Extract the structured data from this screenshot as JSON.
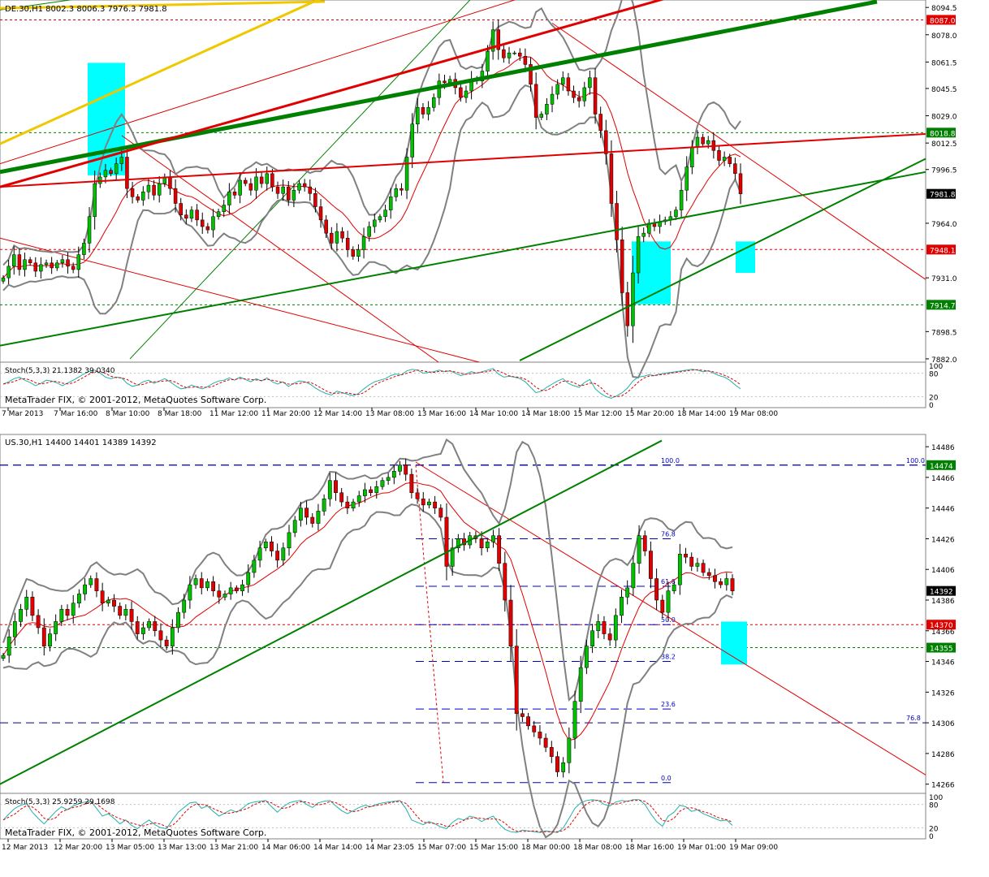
{
  "colors": {
    "bull": "#00c000",
    "bear": "#e00000",
    "band": "#808080",
    "ma": "#e00000",
    "trend_green": "#008000",
    "trend_red": "#e00000",
    "gold": "#f0c800",
    "zone": "#00ffff",
    "fib": "#0000c0",
    "stoch_main": "#20b2aa",
    "stoch_signal": "#e00000",
    "grid": "#c0c0c0"
  },
  "chart_data": [
    {
      "type": "candlestick",
      "symbol_header": "DE.30,H1  8002.3 8006.3 7976.3 7981.8",
      "y_ticks": [
        "8094.5",
        "8078.0",
        "8061.5",
        "8045.5",
        "8029.0",
        "8012.5",
        "7996.5",
        "7964.0",
        "7931.0",
        "7898.5",
        "7882.0"
      ],
      "ylim": [
        7880.0,
        8099.0
      ],
      "price_markers": [
        {
          "label": "8087.0",
          "value": 8087.0,
          "color": "#e00000",
          "style": "dotted"
        },
        {
          "label": "8018.8",
          "value": 8018.8,
          "color": "#008000",
          "style": "dotted"
        },
        {
          "label": "7981.8",
          "value": 7981.8,
          "color": "#000000",
          "style": "current"
        },
        {
          "label": "7948.1",
          "value": 7948.1,
          "color": "#e00000",
          "style": "dotted"
        },
        {
          "label": "7914.7",
          "value": 7914.7,
          "color": "#008000",
          "style": "dotted"
        }
      ],
      "x_ticks": [
        "7 Mar 2013",
        "7 Mar 16:00",
        "8 Mar 10:00",
        "8 Mar 18:00",
        "11 Mar 12:00",
        "11 Mar 20:00",
        "12 Mar 14:00",
        "13 Mar 08:00",
        "13 Mar 16:00",
        "14 Mar 10:00",
        "14 Mar 18:00",
        "15 Mar 12:00",
        "15 Mar 20:00",
        "18 Mar 14:00",
        "19 Mar 08:00"
      ],
      "indicator_label": "Stoch(5,3,3) 21.1382 39.0340",
      "watermark": "MetaTrader FIX, © 2001-2012, MetaQuotes Software Corp.",
      "indicator_ticks": [
        "100",
        "80",
        "20",
        "0"
      ],
      "close": [
        7931,
        7938,
        7945,
        7936,
        7942,
        7940,
        7935,
        7939,
        7940,
        7937,
        7940,
        7942,
        7938,
        7936,
        7945,
        7952,
        7968,
        7988,
        7992,
        7996,
        7994,
        8000,
        8004,
        7985,
        7980,
        7978,
        7983,
        7987,
        7981,
        7988,
        7992,
        7985,
        7976,
        7969,
        7967,
        7972,
        7966,
        7962,
        7960,
        7968,
        7971,
        7975,
        7983,
        7981,
        7990,
        7988,
        7984,
        7992,
        7988,
        7994,
        7986,
        7982,
        7986,
        7978,
        7984,
        7988,
        7986,
        7982,
        7974,
        7966,
        7958,
        7952,
        7959,
        7955,
        7948,
        7944,
        7948,
        7956,
        7962,
        7966,
        7968,
        7972,
        7980,
        7985,
        7984,
        8004,
        8024,
        8034,
        8030,
        8034,
        8040,
        8050,
        8049,
        8051,
        8046,
        8040,
        8044,
        8051,
        8050,
        8056,
        8068,
        8081,
        8069,
        8064,
        8067,
        8067,
        8065,
        8060,
        8048,
        8028,
        8030,
        8036,
        8042,
        8048,
        8052,
        8044,
        8040,
        8038,
        8046,
        8052,
        8030,
        8020,
        8006,
        7976,
        7954,
        7922,
        7902,
        7934,
        7956,
        7958,
        7964,
        7962,
        7965,
        7966,
        7968,
        7972,
        7984,
        7998,
        8010,
        8016,
        8012,
        8014,
        8008,
        8002,
        8004,
        8000,
        7994,
        7981.8
      ],
      "stoch_main": [
        52,
        58,
        66,
        70,
        62,
        56,
        48,
        54,
        62,
        60,
        55,
        48,
        55,
        62,
        70,
        78,
        85,
        88,
        80,
        70,
        66,
        70,
        68,
        54,
        46,
        50,
        58,
        62,
        54,
        60,
        66,
        58,
        48,
        40,
        42,
        50,
        44,
        40,
        46,
        54,
        60,
        62,
        68,
        62,
        70,
        64,
        58,
        66,
        60,
        68,
        58,
        52,
        58,
        46,
        54,
        60,
        58,
        52,
        42,
        34,
        28,
        24,
        34,
        30,
        26,
        22,
        28,
        40,
        50,
        58,
        62,
        66,
        74,
        78,
        76,
        86,
        90,
        88,
        80,
        82,
        84,
        88,
        84,
        86,
        80,
        74,
        78,
        84,
        80,
        84,
        88,
        92,
        78,
        70,
        72,
        70,
        66,
        58,
        44,
        30,
        34,
        44,
        52,
        60,
        66,
        54,
        48,
        44,
        56,
        64,
        40,
        28,
        20,
        16,
        22,
        30,
        42,
        60,
        70,
        72,
        76,
        74,
        78,
        80,
        82,
        84,
        86,
        88,
        90,
        88,
        84,
        86,
        80,
        74,
        70,
        62,
        50,
        40
      ]
    },
    {
      "type": "candlestick",
      "symbol_header": "US.30,H1  14400 14401 14389 14392",
      "y_ticks": [
        "14486",
        "14466",
        "14446",
        "14426",
        "14406",
        "14386",
        "14366",
        "14346",
        "14326",
        "14306",
        "14286",
        "14266"
      ],
      "ylim": [
        14260,
        14494
      ],
      "price_markers": [
        {
          "label": "14474",
          "value": 14474,
          "color": "#008000",
          "style": "dashed"
        },
        {
          "label": "14392",
          "value": 14392,
          "color": "#000000",
          "style": "current"
        },
        {
          "label": "14370",
          "value": 14370,
          "color": "#e00000",
          "style": "dotted"
        },
        {
          "label": "14355",
          "value": 14355,
          "color": "#008000",
          "style": "dotted"
        }
      ],
      "fib_levels": [
        {
          "label": "100.0",
          "value": 14474
        },
        {
          "label": "76.8",
          "value": 14426
        },
        {
          "label": "61.8",
          "value": 14395
        },
        {
          "label": "50.0",
          "value": 14370
        },
        {
          "label": "38.2",
          "value": 14346
        },
        {
          "label": "23.6",
          "value": 14315
        },
        {
          "label": "0.0",
          "value": 14267
        }
      ],
      "fib_ext_labels": [
        {
          "label": "100.0",
          "value": 14474
        },
        {
          "label": "76.8",
          "value": 14306
        }
      ],
      "x_ticks": [
        "12 Mar 2013",
        "12 Mar 20:00",
        "13 Mar 05:00",
        "13 Mar 13:00",
        "13 Mar 21:00",
        "14 Mar 06:00",
        "14 Mar 14:00",
        "14 Mar 23:05",
        "15 Mar 07:00",
        "15 Mar 15:00",
        "18 Mar 00:00",
        "18 Mar 08:00",
        "18 Mar 16:00",
        "19 Mar 01:00",
        "19 Mar 09:00"
      ],
      "indicator_label": "Stoch(5,3,3) 25.9259 29.1698",
      "watermark": "MetaTrader FIX, © 2001-2012, MetaQuotes Software Corp.",
      "indicator_ticks": [
        "100",
        "80",
        "20",
        "0"
      ],
      "close": [
        14350,
        14362,
        14372,
        14380,
        14388,
        14376,
        14368,
        14356,
        14364,
        14372,
        14380,
        14376,
        14384,
        14390,
        14396,
        14400,
        14392,
        14384,
        14386,
        14382,
        14376,
        14380,
        14372,
        14364,
        14368,
        14372,
        14366,
        14360,
        14356,
        14368,
        14378,
        14386,
        14396,
        14400,
        14394,
        14398,
        14392,
        14388,
        14390,
        14394,
        14392,
        14396,
        14404,
        14412,
        14420,
        14424,
        14418,
        14412,
        14420,
        14430,
        14438,
        14446,
        14440,
        14436,
        14444,
        14452,
        14464,
        14456,
        14450,
        14446,
        14450,
        14454,
        14458,
        14456,
        14460,
        14464,
        14466,
        14470,
        14474,
        14468,
        14456,
        14452,
        14448,
        14450,
        14446,
        14440,
        14408,
        14420,
        14426,
        14422,
        14428,
        14426,
        14420,
        14424,
        14428,
        14410,
        14386,
        14356,
        14312,
        14310,
        14304,
        14300,
        14296,
        14290,
        14284,
        14274,
        14280,
        14296,
        14320,
        14342,
        14356,
        14366,
        14372,
        14364,
        14360,
        14376,
        14388,
        14394,
        14410,
        14428,
        14418,
        14400,
        14386,
        14378,
        14392,
        14396,
        14416,
        14414,
        14408,
        14410,
        14404,
        14402,
        14398,
        14396,
        14400,
        14392
      ],
      "stoch_main": [
        40,
        56,
        70,
        78,
        82,
        60,
        44,
        30,
        46,
        62,
        74,
        66,
        76,
        82,
        86,
        88,
        70,
        50,
        56,
        44,
        30,
        40,
        26,
        18,
        30,
        40,
        28,
        20,
        18,
        40,
        60,
        72,
        84,
        86,
        70,
        76,
        62,
        50,
        58,
        66,
        60,
        70,
        82,
        86,
        88,
        90,
        74,
        60,
        74,
        84,
        88,
        90,
        80,
        72,
        84,
        88,
        90,
        76,
        64,
        56,
        64,
        72,
        78,
        74,
        80,
        84,
        86,
        88,
        90,
        70,
        40,
        34,
        28,
        36,
        30,
        22,
        18,
        34,
        44,
        40,
        50,
        46,
        36,
        44,
        50,
        30,
        16,
        10,
        8,
        14,
        12,
        10,
        8,
        12,
        10,
        8,
        20,
        44,
        70,
        84,
        90,
        92,
        90,
        80,
        76,
        86,
        90,
        88,
        92,
        92,
        80,
        56,
        36,
        24,
        50,
        60,
        78,
        74,
        62,
        66,
        56,
        50,
        44,
        38,
        40,
        26
      ]
    }
  ]
}
